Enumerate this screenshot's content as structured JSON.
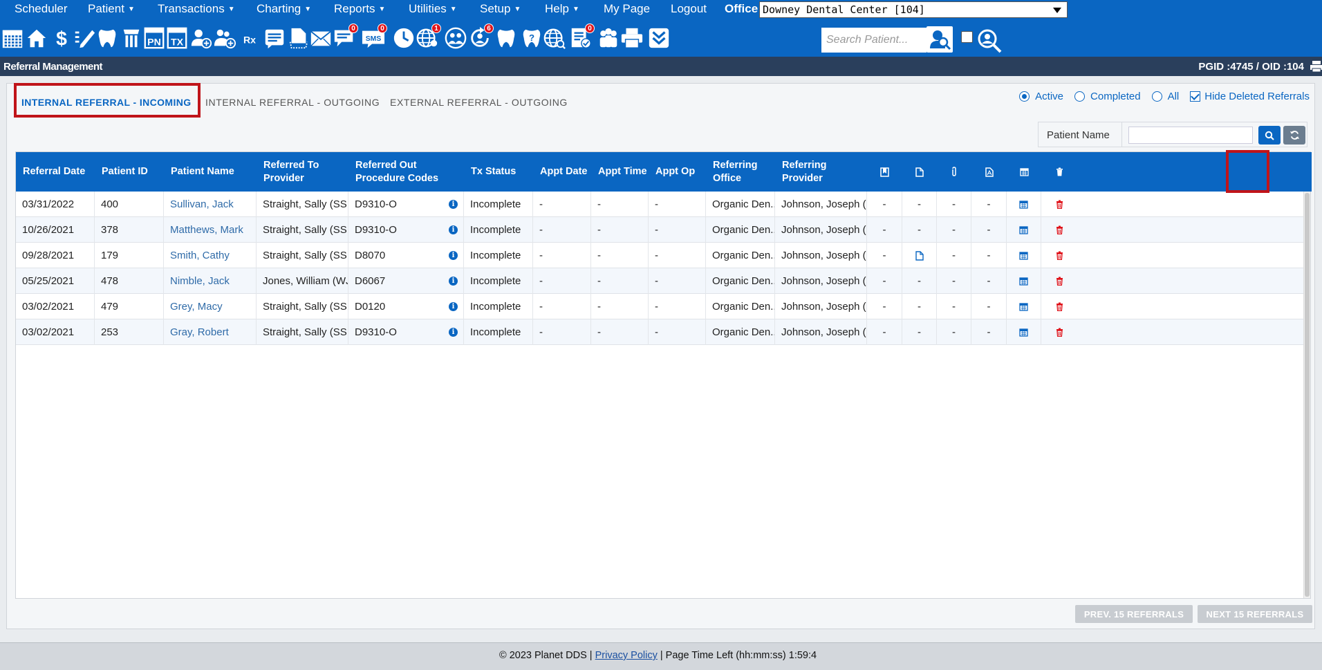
{
  "menu": {
    "items": [
      {
        "label": "Scheduler",
        "caret": false
      },
      {
        "label": "Patient",
        "caret": true
      },
      {
        "label": "Transactions",
        "caret": true
      },
      {
        "label": "Charting",
        "caret": true
      },
      {
        "label": "Reports",
        "caret": true
      },
      {
        "label": "Utilities",
        "caret": true
      },
      {
        "label": "Setup",
        "caret": true
      },
      {
        "label": "Help",
        "caret": true
      },
      {
        "label": "My Page",
        "caret": false
      },
      {
        "label": "Logout",
        "caret": false
      }
    ],
    "office_label": "Office",
    "office_value": "Downey Dental Center [104]"
  },
  "toolbar": {
    "icons": [
      {
        "name": "calendar-icon",
        "text": ""
      },
      {
        "name": "home-icon",
        "text": ""
      },
      {
        "name": "dollar-icon",
        "text": "$"
      },
      {
        "name": "edit-icon",
        "text": ""
      },
      {
        "name": "tooth-chart-icon",
        "text": ""
      },
      {
        "name": "perio-icon",
        "text": ""
      },
      {
        "name": "progress-notes-icon",
        "text": "PN"
      },
      {
        "name": "treatment-icon",
        "text": "TX"
      },
      {
        "name": "add-patient-icon",
        "text": ""
      },
      {
        "name": "add-family-icon",
        "text": ""
      },
      {
        "name": "prescription-icon",
        "text": "Rx"
      },
      {
        "name": "notes-icon",
        "text": ""
      },
      {
        "name": "document-icon",
        "text": ""
      },
      {
        "name": "email-icon",
        "text": ""
      },
      {
        "name": "messages-icon",
        "text": "",
        "badge": "0"
      },
      {
        "name": "sms-icon",
        "text": "SMS",
        "badge": "0"
      },
      {
        "name": "clock-icon",
        "text": ""
      },
      {
        "name": "web-alert-icon",
        "text": "",
        "badge": "1"
      },
      {
        "name": "web-users-icon",
        "text": ""
      },
      {
        "name": "recall-icon",
        "text": "",
        "badge": "6"
      },
      {
        "name": "tooth-icon",
        "text": ""
      },
      {
        "name": "tooth-help-icon",
        "text": "?"
      },
      {
        "name": "globe-search-icon",
        "text": ""
      },
      {
        "name": "form-check-icon",
        "text": "",
        "badge": "0"
      },
      {
        "name": "group-icon",
        "text": ""
      },
      {
        "name": "printer-icon",
        "text": ""
      },
      {
        "name": "expand-down-icon",
        "text": ""
      }
    ],
    "search_placeholder": "Search Patient..."
  },
  "titlebar": {
    "title": "Referral Management",
    "ids": "PGID :4745  /  OID :104"
  },
  "tabs": [
    "INTERNAL REFERRAL - INCOMING",
    "INTERNAL REFERRAL - OUTGOING",
    "EXTERNAL REFERRAL - OUTGOING"
  ],
  "filters": {
    "active": "Active",
    "completed": "Completed",
    "all": "All",
    "hide_deleted": "Hide Deleted Referrals"
  },
  "patient_filter": {
    "label": "Patient Name",
    "value": ""
  },
  "grid": {
    "columns": [
      "Referral Date",
      "Patient ID",
      "Patient Name",
      "Referred To Provider",
      "Referred Out Procedure Codes",
      "Tx Status",
      "Appt Date",
      "Appt Time",
      "Appt Op",
      "Referring Office",
      "Referring Provider"
    ],
    "icon_columns": [
      "bookmark-icon",
      "document-icon",
      "attachment-icon",
      "pdf-icon",
      "calendar-icon",
      "trash-icon"
    ],
    "rows": [
      {
        "date": "03/31/2022",
        "pid": "400",
        "name": "Sullivan, Jack",
        "to": "Straight, Sally (SS ...",
        "codes": "D9310-O",
        "status": "Incomplete",
        "appt_date": "-",
        "appt_time": "-",
        "appt_op": "-",
        "office": "Organic Den...",
        "provider": "Johnson, Joseph (J...",
        "c1": "-",
        "c2": "-",
        "c3": "-",
        "c4": "-"
      },
      {
        "date": "10/26/2021",
        "pid": "378",
        "name": "Matthews, Mark",
        "to": "Straight, Sally (SS ...",
        "codes": "D9310-O",
        "status": "Incomplete",
        "appt_date": "-",
        "appt_time": "-",
        "appt_op": "-",
        "office": "Organic Den...",
        "provider": "Johnson, Joseph (J...",
        "c1": "-",
        "c2": "-",
        "c3": "-",
        "c4": "-"
      },
      {
        "date": "09/28/2021",
        "pid": "179",
        "name": "Smith, Cathy",
        "to": "Straight, Sally (SS ...",
        "codes": "D8070",
        "status": "Incomplete",
        "appt_date": "-",
        "appt_time": "-",
        "appt_op": "-",
        "office": "Organic Den...",
        "provider": "Johnson, Joseph (J...",
        "c1": "-",
        "c2": "doc",
        "c3": "-",
        "c4": "-"
      },
      {
        "date": "05/25/2021",
        "pid": "478",
        "name": "Nimble, Jack",
        "to": "Jones, William (WJ...",
        "codes": "D6067",
        "status": "Incomplete",
        "appt_date": "-",
        "appt_time": "-",
        "appt_op": "-",
        "office": "Organic Den...",
        "provider": "Johnson, Joseph (J...",
        "c1": "-",
        "c2": "-",
        "c3": "-",
        "c4": "-"
      },
      {
        "date": "03/02/2021",
        "pid": "479",
        "name": "Grey, Macy",
        "to": "Straight, Sally (SS ...",
        "codes": "D0120",
        "status": "Incomplete",
        "appt_date": "-",
        "appt_time": "-",
        "appt_op": "-",
        "office": "Organic Den...",
        "provider": "Johnson, Joseph (J...",
        "c1": "-",
        "c2": "-",
        "c3": "-",
        "c4": "-"
      },
      {
        "date": "03/02/2021",
        "pid": "253",
        "name": "Gray, Robert",
        "to": "Straight, Sally (SS ...",
        "codes": "D9310-O",
        "status": "Incomplete",
        "appt_date": "-",
        "appt_time": "-",
        "appt_op": "-",
        "office": "Organic Den...",
        "provider": "Johnson, Joseph (J...",
        "c1": "-",
        "c2": "-",
        "c3": "-",
        "c4": "-"
      }
    ]
  },
  "pager": {
    "prev": "PREV. 15 REFERRALS",
    "next": "NEXT 15 REFERRALS"
  },
  "footer": {
    "copyright": "© 2023 Planet DDS | ",
    "privacy": "Privacy Policy",
    "time_left": " |  Page Time Left (hh:mm:ss) 1:59:4"
  },
  "colors": {
    "brand_blue": "#0a66c2",
    "highlight_red": "#c0141a",
    "title_navy": "#2a3f5c"
  }
}
